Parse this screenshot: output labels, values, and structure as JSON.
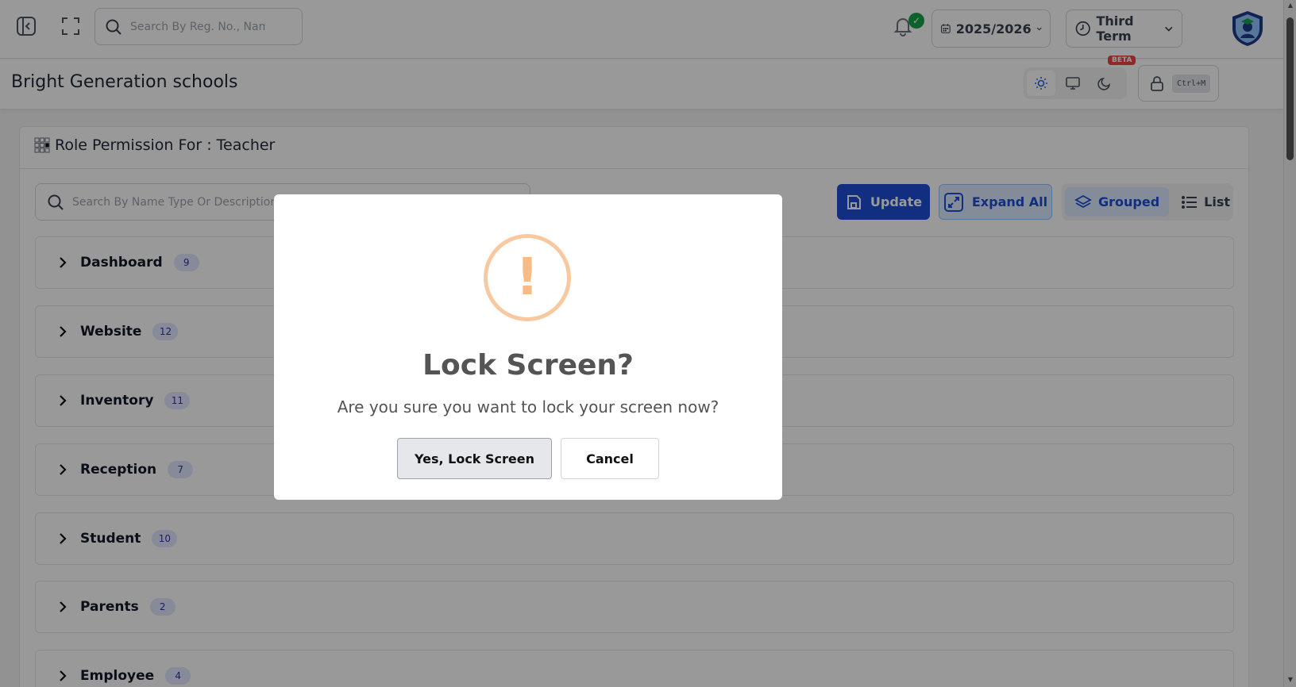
{
  "topbar": {
    "search_placeholder": "Search By Reg. No., Name",
    "notification_badge": "✓",
    "session": "2025/2026",
    "term": "Third Term"
  },
  "subheader": {
    "school_name": "Bright Generation schools",
    "beta_label": "BETA",
    "lock_shortcut": "Ctrl+M"
  },
  "content": {
    "title": "Role Permission For : Teacher",
    "search_placeholder": "Search By Name Type Or Description...",
    "update_label": "Update",
    "expand_label": "Expand All",
    "grouped_label": "Grouped",
    "list_label": "List",
    "modules": [
      {
        "name": "Dashboard",
        "count": "9"
      },
      {
        "name": "Website",
        "count": "12"
      },
      {
        "name": "Inventory",
        "count": "11"
      },
      {
        "name": "Reception",
        "count": "7"
      },
      {
        "name": "Student",
        "count": "10"
      },
      {
        "name": "Parents",
        "count": "2"
      },
      {
        "name": "Employee",
        "count": "4"
      }
    ]
  },
  "modal": {
    "icon_glyph": "!",
    "title": "Lock Screen?",
    "text": "Are you sure you want to lock your screen now?",
    "confirm_label": "Yes, Lock Screen",
    "cancel_label": "Cancel"
  },
  "colors": {
    "primary": "#1d4ed8",
    "warning": "#f8bb86",
    "success": "#16a34a",
    "beta": "#ef4444"
  }
}
